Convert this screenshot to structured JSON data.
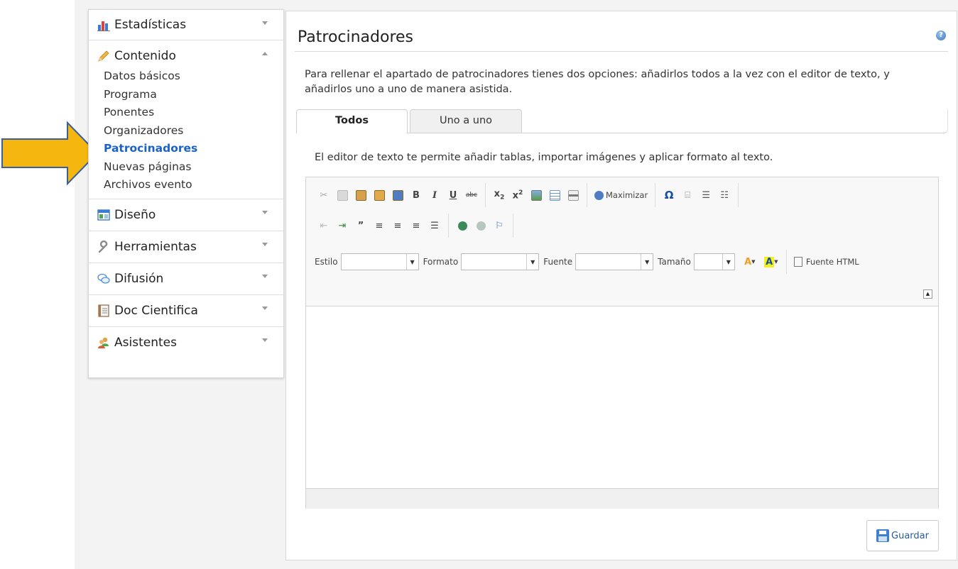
{
  "sidebar": {
    "sections": [
      {
        "label": "Estadísticas",
        "icon": "bar-chart-icon",
        "expanded": false
      },
      {
        "label": "Contenido",
        "icon": "pencil-icon",
        "expanded": true,
        "items": [
          "Datos básicos",
          "Programa",
          "Ponentes",
          "Organizadores",
          "Patrocinadores",
          "Nuevas páginas",
          "Archivos evento"
        ],
        "active_item": "Patrocinadores"
      },
      {
        "label": "Diseño",
        "icon": "layout-icon",
        "expanded": false
      },
      {
        "label": "Herramientas",
        "icon": "wrench-icon",
        "expanded": false
      },
      {
        "label": "Difusión",
        "icon": "speech-bubbles-icon",
        "expanded": false
      },
      {
        "label": "Doc Cientifica",
        "icon": "document-icon",
        "expanded": false
      },
      {
        "label": "Asistentes",
        "icon": "users-icon",
        "expanded": false
      }
    ]
  },
  "main": {
    "title": "Patrocinadores",
    "intro": "Para rellenar el apartado de patrocinadores tienes dos opciones: añadirlos todos a la vez con el editor de texto, y añadirlos uno a uno de manera asistida.",
    "tabs": [
      {
        "label": "Todos",
        "active": true
      },
      {
        "label": "Uno a uno",
        "active": false
      }
    ],
    "editor_description": "El editor de texto te permite añadir tablas, importar imágenes y aplicar formato al texto.",
    "save_label": "Guardar"
  },
  "editor": {
    "maximize_label": "Maximizar",
    "style_label": "Estilo",
    "format_label": "Formato",
    "font_label": "Fuente",
    "size_label": "Tamaño",
    "source_label": "Fuente HTML"
  },
  "colors": {
    "active_link": "#1a63c4",
    "arrow_fill": "#f5b70f",
    "arrow_stroke": "#3a5f9c"
  }
}
